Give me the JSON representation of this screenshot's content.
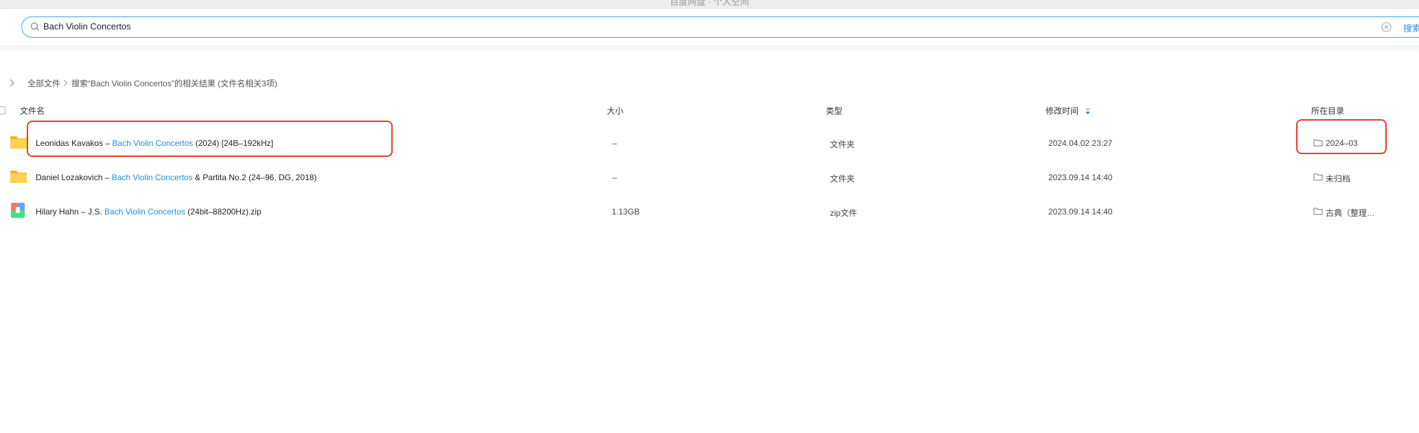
{
  "window": {
    "title": "百度网盘 · 个人空间"
  },
  "search": {
    "query": "Bach Violin Concertos",
    "button_label": "搜索"
  },
  "breadcrumb": {
    "root": "全部文件",
    "current": "搜索“Bach Violin Concertos”的相关结果 (文件名相关3项)"
  },
  "columns": {
    "name": "文件名",
    "size": "大小",
    "type": "类型",
    "modified": "修改时间",
    "dir": "所在目录"
  },
  "files": [
    {
      "name_pre": "Leonidas Kavakos – ",
      "name_hl": "Bach Violin Concertos",
      "name_post": " (2024) [24B–192kHz]",
      "size": "–",
      "type": "文件夹",
      "modified": "2024.04.02 23:27",
      "dir": "2024–03",
      "icon": "folder-icon"
    },
    {
      "name_pre": "Daniel Lozakovich – ",
      "name_hl": "Bach Violin Concertos",
      "name_post": " & Partita No.2 (24–96, DG, 2018)",
      "size": "–",
      "type": "文件夹",
      "modified": "2023.09.14 14:40",
      "dir": "未归档",
      "icon": "folder-icon"
    },
    {
      "name_pre": "Hilary Hahn – J.S. ",
      "name_hl": "Bach Violin Concertos",
      "name_post": " (24bit–88200Hz).zip",
      "size": "1.13GB",
      "type": "zip文件",
      "modified": "2023.09.14 14:40",
      "dir": "古典（整理…",
      "icon": "zip-archive-icon"
    }
  ],
  "colors": {
    "accent": "#1e8fe0",
    "highlight_box": "#e63a2e",
    "folder": "#f6c23c"
  }
}
